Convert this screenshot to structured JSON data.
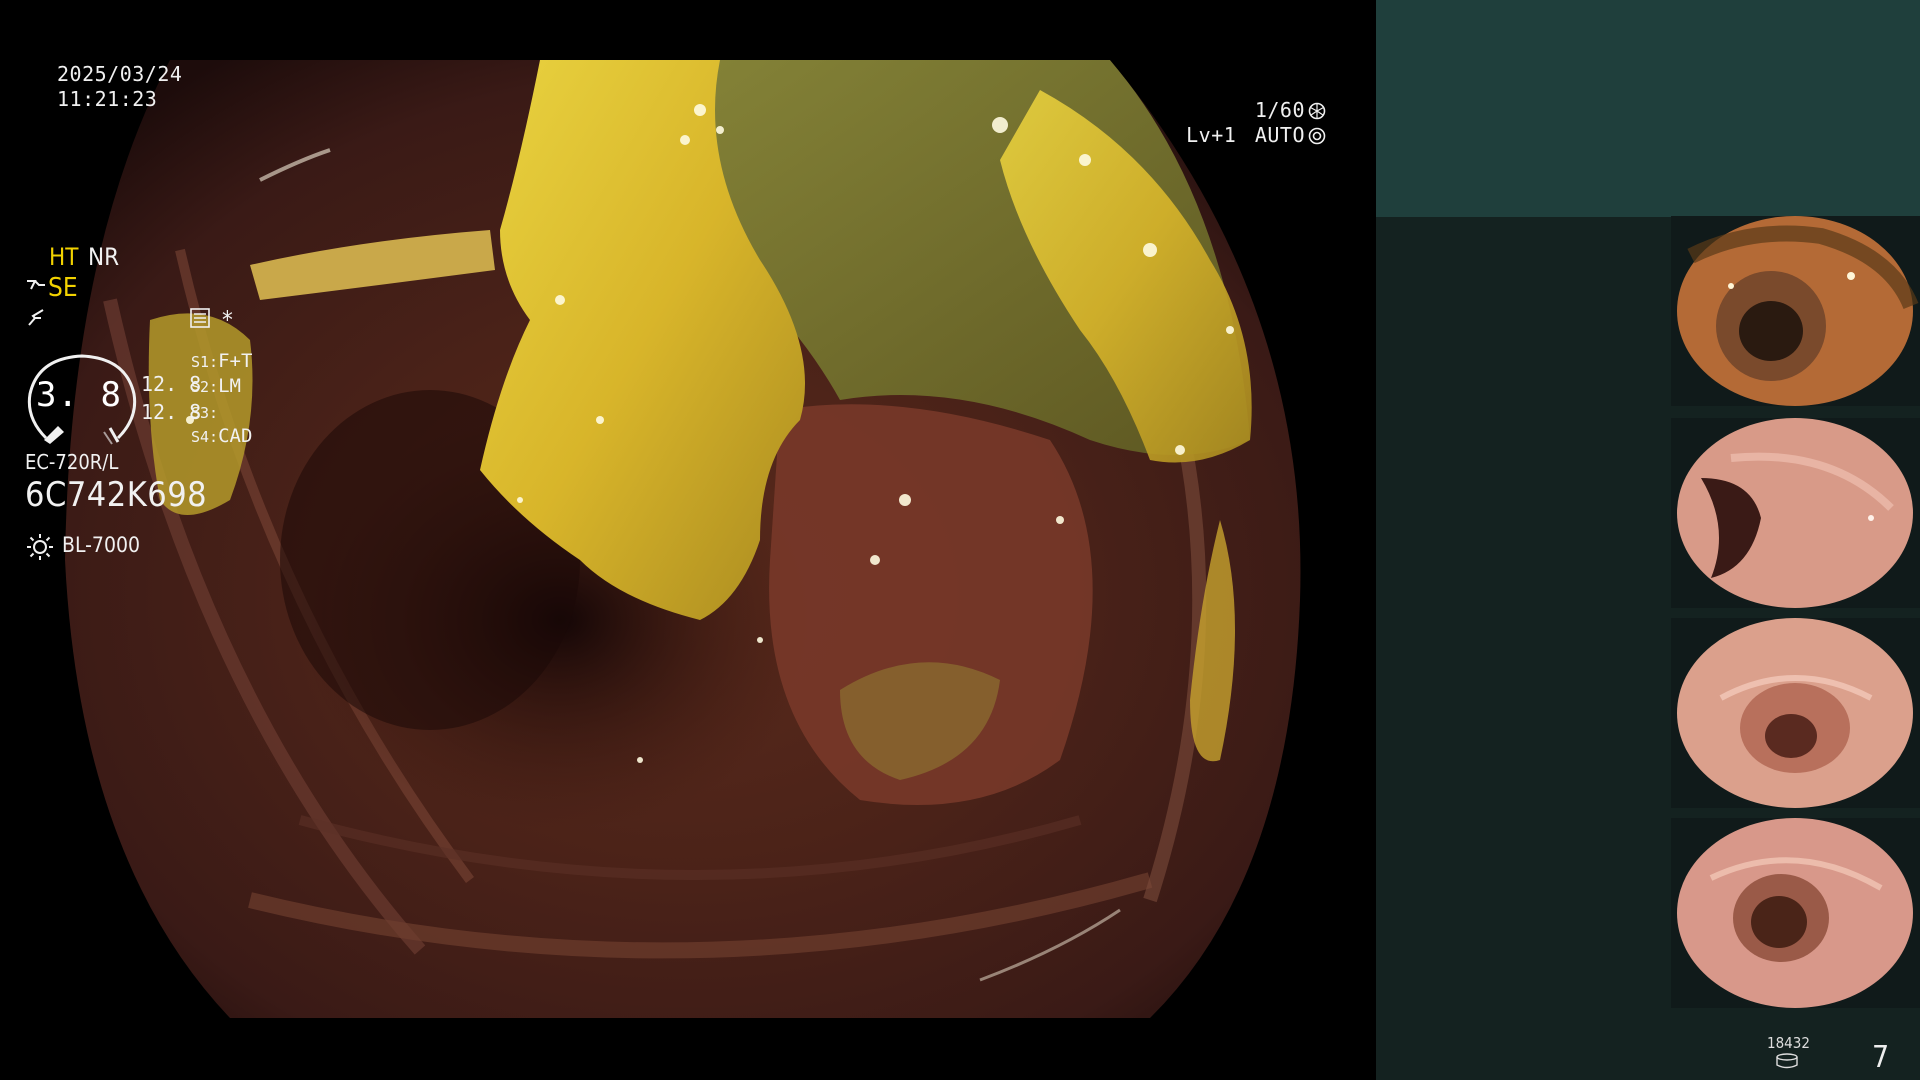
{
  "main_view": {
    "date": "2025/03/24",
    "time": "11:21:23",
    "shutter": "1/60",
    "level": "Lv+1",
    "iris_mode": "AUTO",
    "scene": "colon-lumen-with-yellow-stool-residue"
  },
  "panel": {
    "mode_ht": "HT",
    "mode_nr": "NR",
    "mode_se": "SE",
    "asterisk": "*",
    "gauge_value": "3. 8",
    "value_1": "12. 8",
    "value_2": "12. 8",
    "switches": [
      {
        "key": "S1:",
        "value": "F+T"
      },
      {
        "key": "S2:",
        "value": "LM"
      },
      {
        "key": "S3:",
        "value": ""
      },
      {
        "key": "S4:",
        "value": "CAD"
      }
    ],
    "scope_model": "EC-720R/L",
    "scope_serial": "6C742K698",
    "light_source": "BL-7000",
    "storage_count": "18432",
    "page_number": "7"
  },
  "colors": {
    "panel_top": "#1f3f3c",
    "panel_body": "#142220",
    "mode_highlight": "#f2d200"
  },
  "thumbnails": [
    {
      "name": "thumbnail-1",
      "scene": "lumen-with-stool"
    },
    {
      "name": "thumbnail-2",
      "scene": "lumen-fold"
    },
    {
      "name": "thumbnail-3",
      "scene": "lumen-center"
    },
    {
      "name": "thumbnail-4",
      "scene": "lumen-center"
    }
  ]
}
